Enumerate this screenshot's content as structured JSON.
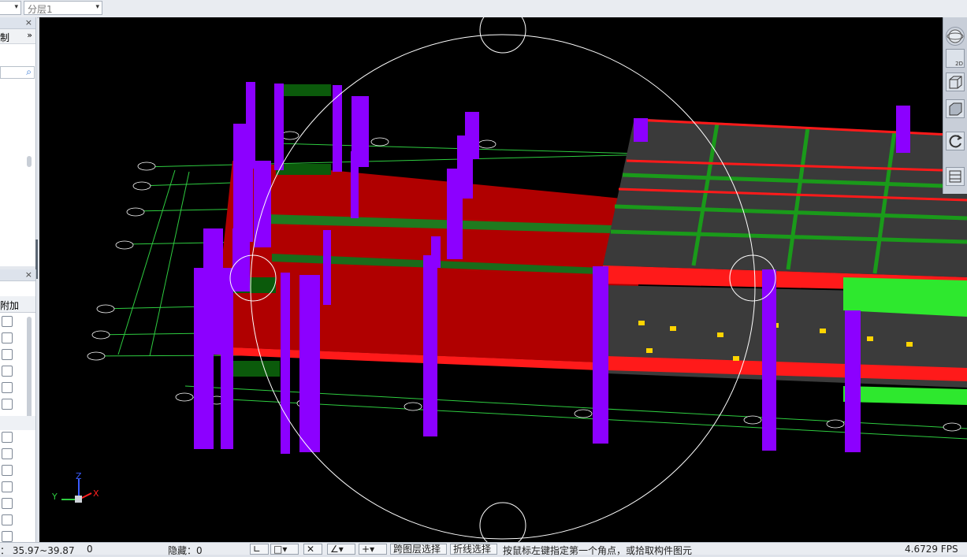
{
  "toolbar": {
    "floor_select": "",
    "layer_select": "分层1"
  },
  "left_panel": {
    "top_pane_label": "制",
    "bottom_pane_header": "附加"
  },
  "icons": {
    "close": "×",
    "expand": "»",
    "search": "⌕",
    "dropdown": "▾"
  },
  "right_toolbar": {
    "view2d_caption": "2D"
  },
  "axes": {
    "x": "X",
    "y": "Y",
    "z": "Z"
  },
  "colors": {
    "background": "#000000",
    "column": "#8c00ff",
    "slab": "#c00000",
    "beam_green": "#1a9a1a",
    "roof": "#3a3a3a",
    "grid_line": "#2ecc40"
  },
  "status": {
    "coords": "： 35.97~39.87",
    "zero": "0",
    "hidden": "隐藏：0",
    "btn_cross_layer": "跨图层选择",
    "btn_polyline": "折线选择",
    "hint": "按鼠标左键指定第一个角点，或拾取构件图元",
    "fps": "4.6729 FPS"
  }
}
